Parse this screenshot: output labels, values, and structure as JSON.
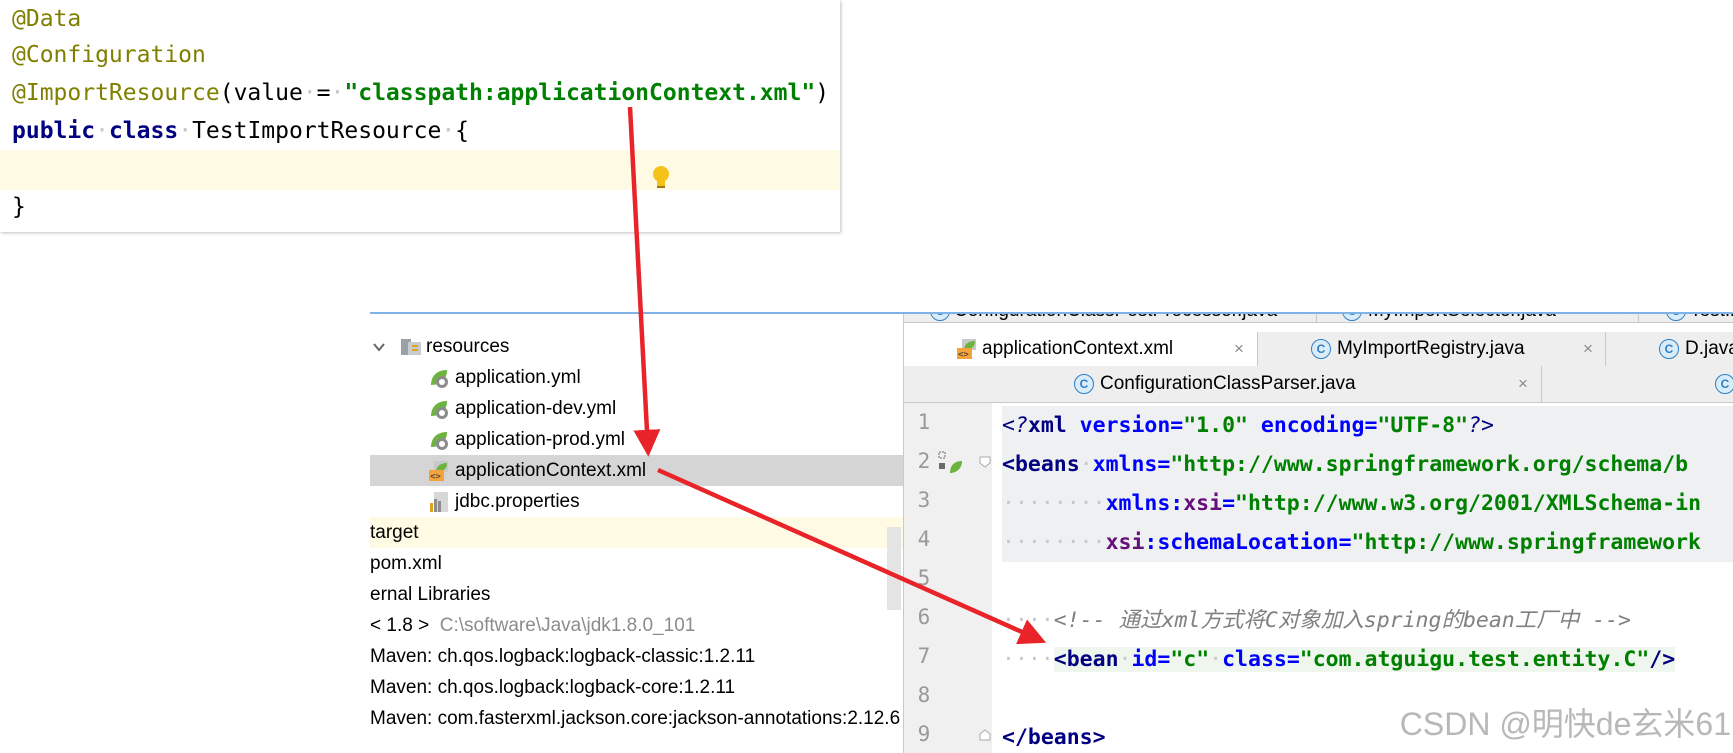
{
  "java": {
    "line1": "@Data",
    "line2": "@Configuration",
    "line3_anno": "@ImportResource",
    "line3_open": "(value",
    "line3_eq": "=",
    "line3_str": "\"classpath:applicationContext.xml\"",
    "line3_close": ")",
    "line4_kw1": "public",
    "line4_kw2": "class",
    "line4_name": "TestImportResource",
    "line4_brace": "{",
    "line6": "}"
  },
  "tree": {
    "resources": "resources",
    "app_yml": "application.yml",
    "app_dev_yml": "application-dev.yml",
    "app_prod_yml": "application-prod.yml",
    "app_ctx_xml": "applicationContext.xml",
    "jdbc_props": "jdbc.properties",
    "target": "target",
    "pom": "pom.xml",
    "ext_libs": "ernal Libraries",
    "jdk_label": "< 1.8 >",
    "jdk_path": "C:\\software\\Java\\jdk1.8.0_101",
    "maven1": "Maven: ch.qos.logback:logback-classic:1.2.11",
    "maven2": "Maven: ch.qos.logback:logback-core:1.2.11",
    "maven3": "Maven: com.fasterxml.jackson.core:jackson-annotations:2.12.6"
  },
  "tabs": {
    "row0": [
      "ConfigurationClassPostProcessor.java",
      "MyImportSelector.java",
      "TestImpo"
    ],
    "t_appctx": "applicationContext.xml",
    "t_registry": "MyImportRegistry.java",
    "t_d": "D.java",
    "t_parser": "ConfigurationClassParser.java",
    "close": "×",
    "c_letter": "C"
  },
  "xml": {
    "lines": [
      "1",
      "2",
      "3",
      "4",
      "5",
      "6",
      "7",
      "8",
      "9"
    ],
    "l1_a": "<?",
    "l1_b": "xml",
    "l1_c": " version=",
    "l1_d": "\"1.0\"",
    "l1_e": " encoding=",
    "l1_f": "\"UTF-8\"",
    "l1_g": "?>",
    "l2_tag": "beans",
    "l2_attr": "xmlns=",
    "l2_val": "\"http://www.springframework.org/schema/b",
    "l3_ns": "xmlns:",
    "l3_attr": "xsi",
    "l3_eq": "=",
    "l3_val": "\"http://www.w3.org/2001/XMLSchema-in",
    "l4_ns": "xsi",
    "l4_attr": ":schemaLocation=",
    "l4_val": "\"http://www.springframework",
    "l6": "<!-- 通过xml方式将C对象加入spring的bean工厂中 -->",
    "l7_tag": "bean",
    "l7_a1": "id=",
    "l7_v1": "\"c\"",
    "l7_a2": "class=",
    "l7_v2": "\"com.atguigu.test.entity.C\"",
    "l7_end": "/>",
    "l9_tag": "beans"
  },
  "watermark": "CSDN @明快de玄米61",
  "colors": {
    "arrow": "#e8242a",
    "annotation": "#808000",
    "keyword": "#000080",
    "string": "#008000"
  }
}
